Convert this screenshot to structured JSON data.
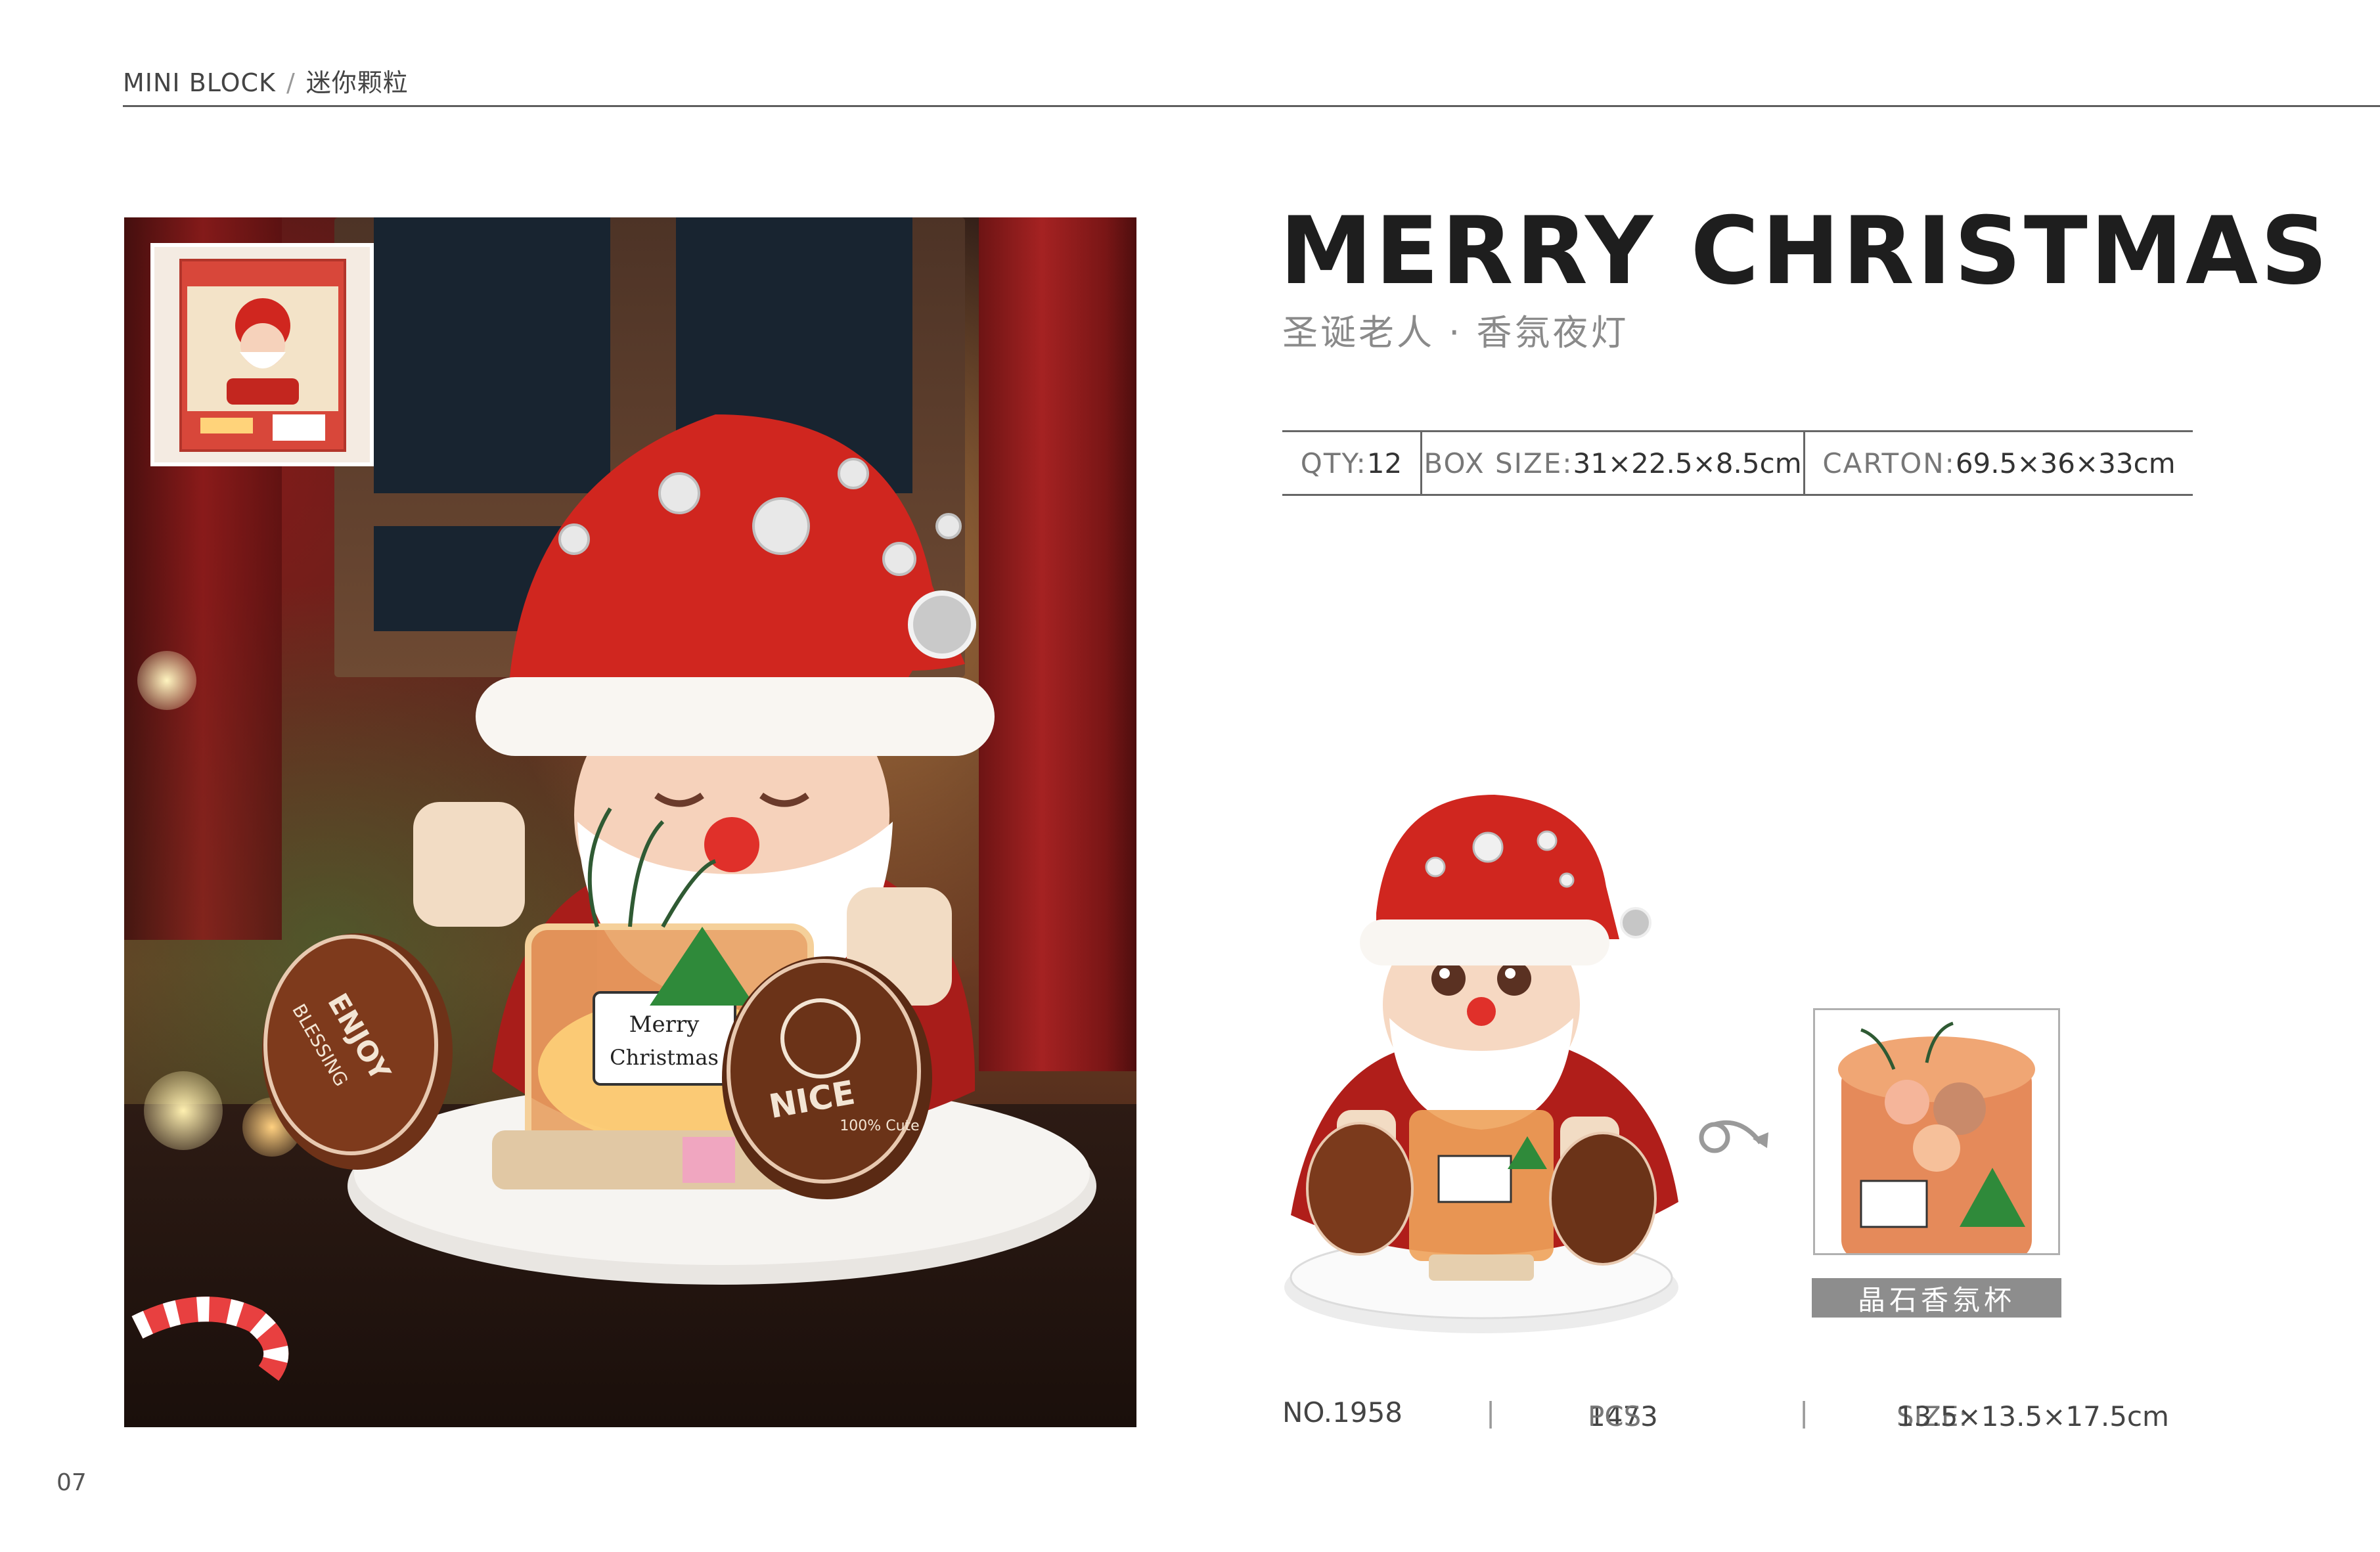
{
  "header": {
    "series_en": "MINI BLOCK",
    "separator": "/",
    "series_cn": "迷你颗粒"
  },
  "product": {
    "title": "MERRY CHRISTMAS",
    "subtitle": "圣诞老人 · 香氛夜灯",
    "specs": [
      {
        "label": "QTY:",
        "value": "12"
      },
      {
        "label": "BOX SIZE:",
        "value": "31×22.5×8.5cm"
      },
      {
        "label": "CARTON:",
        "value": "69.5×36×33cm"
      }
    ],
    "accessory_label": "晶石香氛杯",
    "number": "NO.1958",
    "pieces_value": "1473",
    "pieces_unit": "PCS",
    "size_label": "SIZE:",
    "size_value": "13.5×13.5×17.5cm",
    "footer_separator": "|"
  },
  "photo_text": {
    "jar_label_line1": "Merry",
    "jar_label_line2": "Christmas",
    "left_badge": "ENJOY",
    "left_badge_sub": "BLESSING",
    "right_badge": "NICE",
    "right_badge_sub": "100% Cute"
  },
  "page": {
    "number": "07"
  },
  "colors": {
    "santa_red": "#d0261f",
    "heading": "#1e1e1e",
    "rule": "#5e5e5e",
    "accessory_label_bg": "#8d8d8d"
  }
}
